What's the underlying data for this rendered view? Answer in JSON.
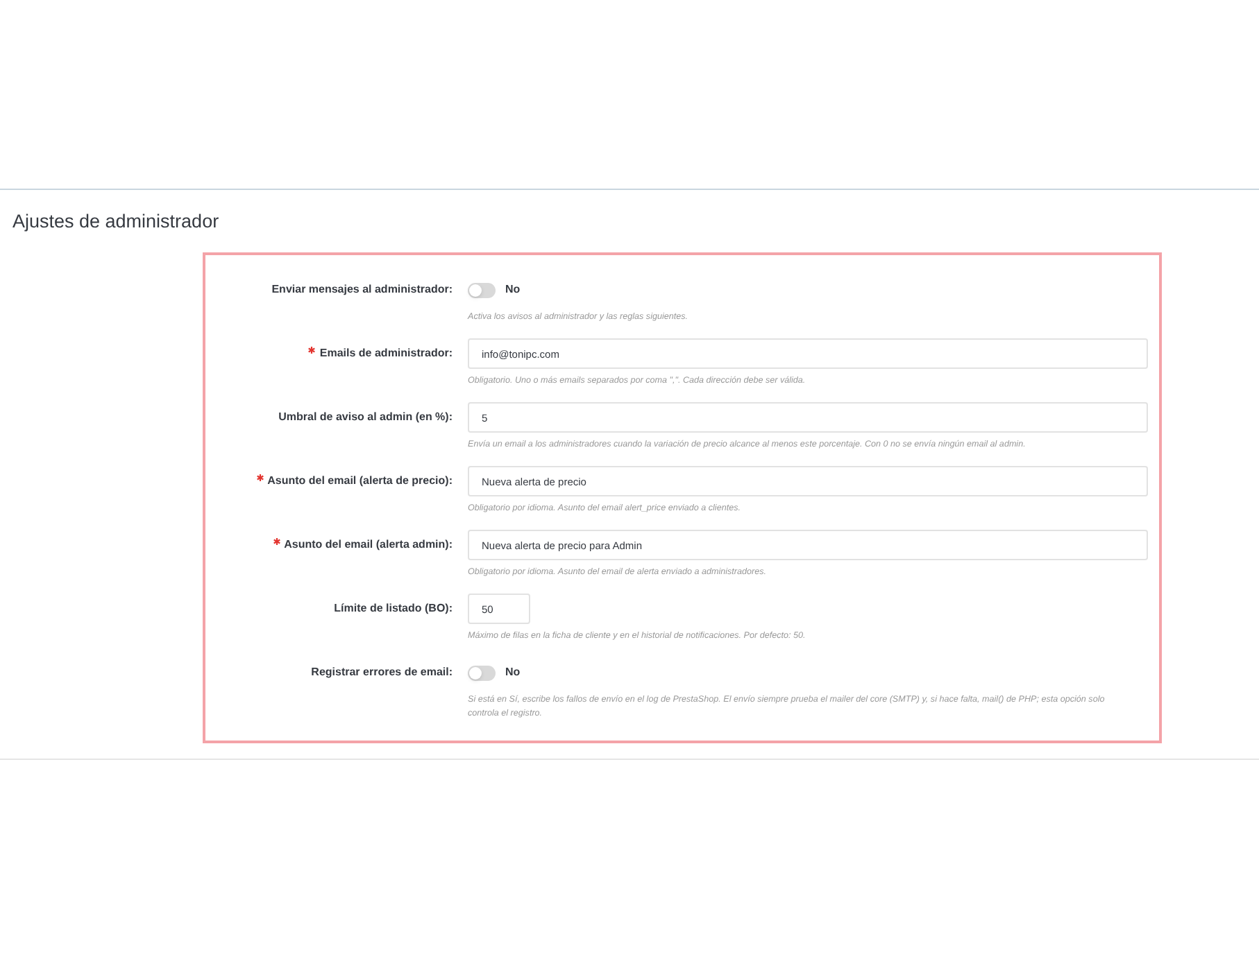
{
  "section_title": "Ajustes de administrador",
  "fields": [
    {
      "kind": "toggle",
      "label": "Enviar mensajes al administrador:",
      "required": false,
      "on": false,
      "value": "No",
      "help": "Activa los avisos al administrador y las reglas siguientes."
    },
    {
      "kind": "text",
      "label": "Emails de administrador:",
      "required": true,
      "value": "info@tonipc.com",
      "help": "Obligatorio. Uno o más emails separados por coma \",\". Cada dirección debe ser válida."
    },
    {
      "kind": "text",
      "label": "Umbral de aviso al admin (en %):",
      "required": false,
      "value": "5",
      "help": "Envía un email a los administradores cuando la variación de precio alcance al menos este porcentaje. Con 0 no se envía ningún email al admin."
    },
    {
      "kind": "text",
      "label": "Asunto del email (alerta de precio):",
      "required": true,
      "value": "Nueva alerta de precio",
      "help": "Obligatorio por idioma. Asunto del email alert_price enviado a clientes."
    },
    {
      "kind": "text",
      "label": "Asunto del email (alerta admin):",
      "required": true,
      "value": "Nueva alerta de precio para Admin",
      "help": "Obligatorio por idioma. Asunto del email de alerta enviado a administradores."
    },
    {
      "kind": "short",
      "label": "Límite de listado (BO):",
      "required": false,
      "value": "50",
      "help": "Máximo de filas en la ficha de cliente y en el historial de notificaciones. Por defecto: 50."
    },
    {
      "kind": "toggle",
      "label": "Registrar errores de email:",
      "required": false,
      "on": false,
      "value": "No",
      "help": "Si está en Sí, escribe los fallos de envío en el log de PrestaShop. El envío siempre prueba el mailer del core (SMTP) y, si hace falta, mail() de PHP; esta opción solo controla el registro."
    }
  ]
}
